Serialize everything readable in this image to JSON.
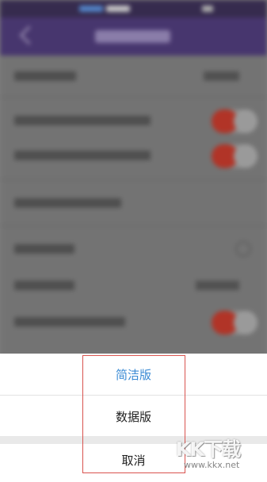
{
  "action_sheet": {
    "options": [
      {
        "label": "简洁版",
        "selected": true
      },
      {
        "label": "数据版",
        "selected": false
      }
    ],
    "cancel_label": "取消"
  },
  "colors": {
    "accent": "#3a8ad4",
    "header": "#4e3b78",
    "toggle_on": "#c0392b",
    "highlight_box": "#d9534f"
  },
  "watermark": {
    "logo": "KK下载",
    "url": "www.kkx.net"
  }
}
